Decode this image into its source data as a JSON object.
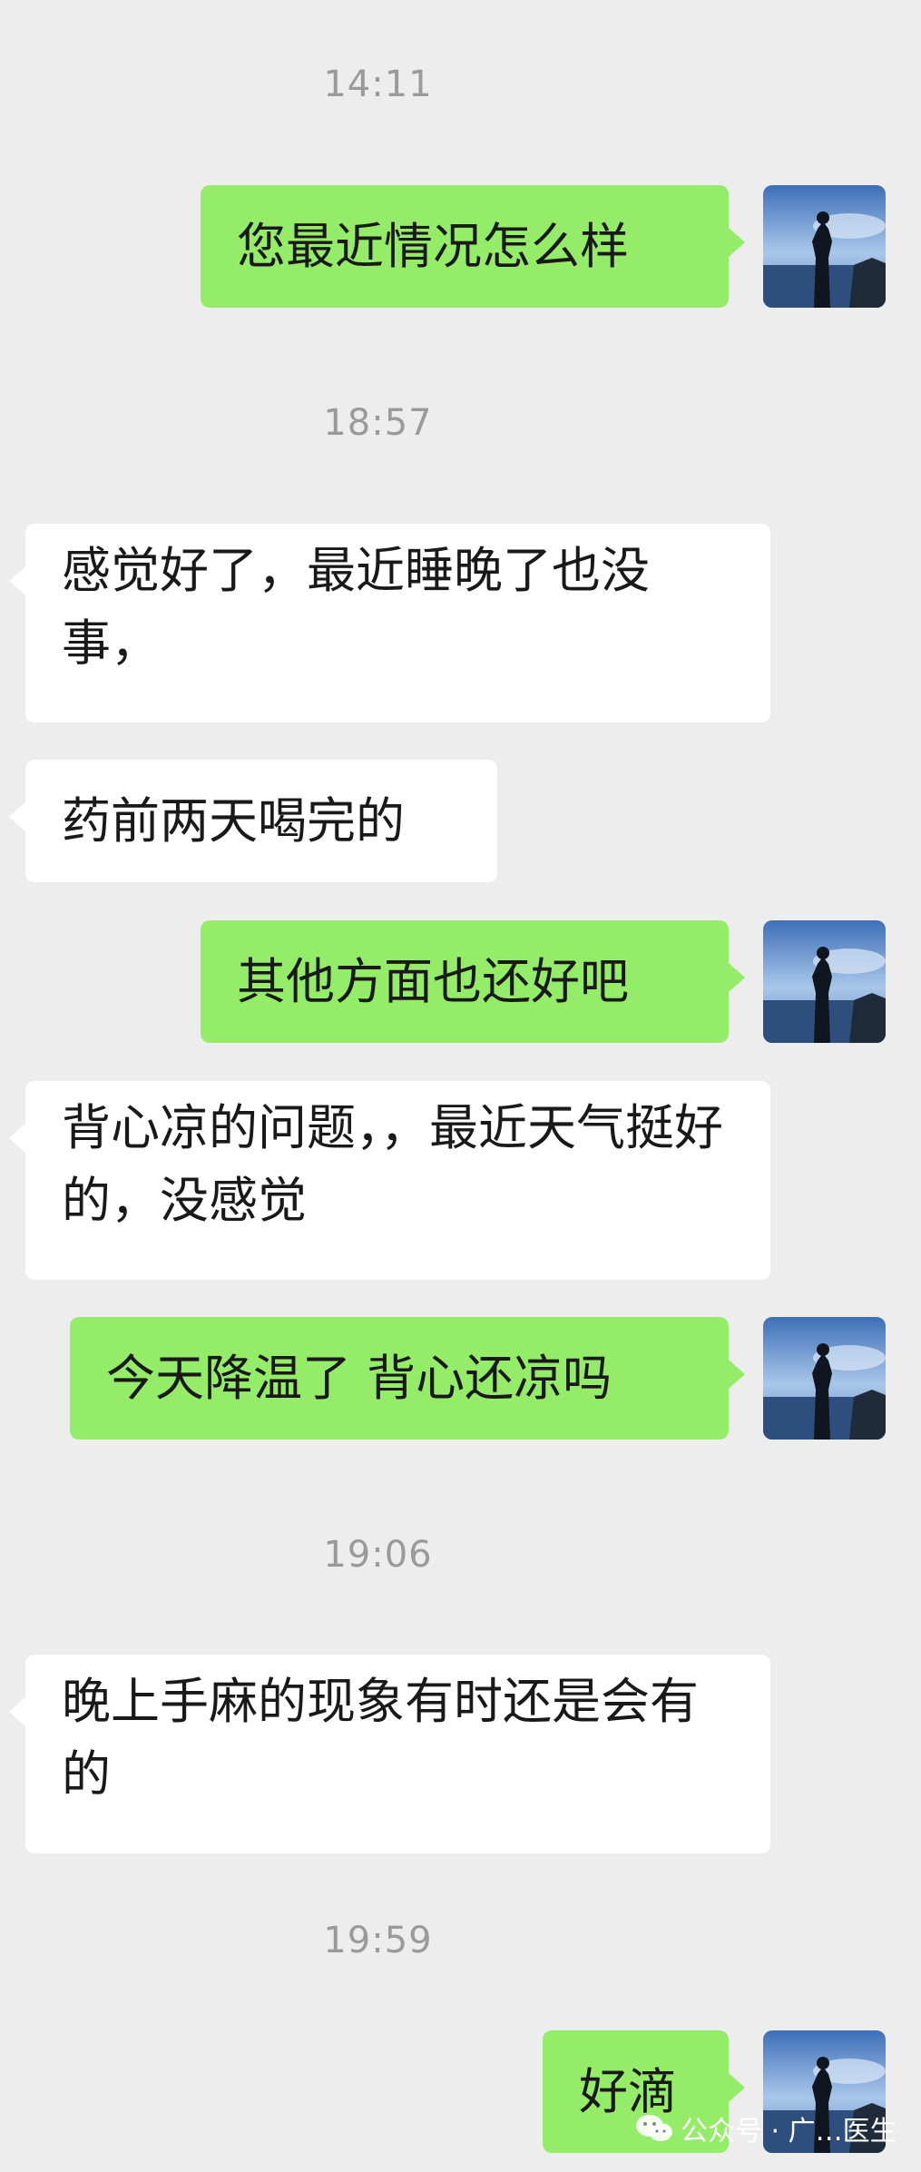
{
  "chat": {
    "timestamps": [
      "14:11",
      "18:57",
      "19:06",
      "19:59"
    ],
    "messages": [
      {
        "side": "right",
        "text": "您最近情况怎么样"
      },
      {
        "side": "left",
        "text": "感觉好了，最近睡晚了也没事，"
      },
      {
        "side": "left",
        "text": "药前两天喝完的"
      },
      {
        "side": "right",
        "text": "其他方面也还好吧"
      },
      {
        "side": "left",
        "text": "背心凉的问题，，最近天气挺好的，没感觉"
      },
      {
        "side": "right",
        "text": "今天降温了 背心还凉吗"
      },
      {
        "side": "left",
        "text": "晚上手麻的现象有时还是会有的"
      },
      {
        "side": "right",
        "text": "好滴"
      }
    ]
  },
  "watermark": {
    "text": "公众号 · 广…医生",
    "icon": "wechat-icon"
  },
  "colors": {
    "background": "#ededed",
    "sent_bubble": "#95ec69",
    "received_bubble": "#ffffff",
    "timestamp": "#9a9a9a"
  },
  "avatar": {
    "icon": "seaside-silhouette-avatar"
  }
}
